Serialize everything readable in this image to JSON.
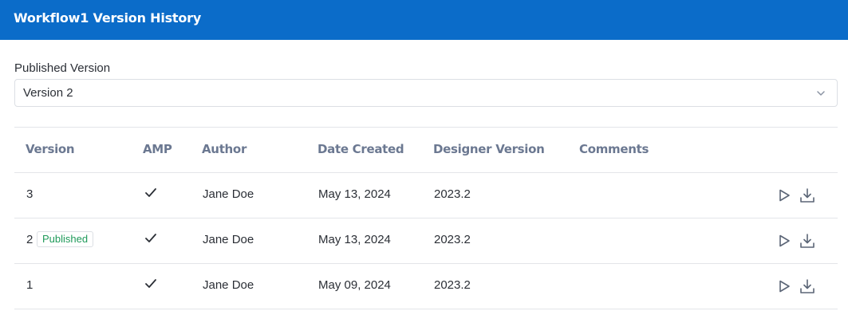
{
  "header": {
    "title": "Workflow1 Version History"
  },
  "published_select": {
    "label": "Published Version",
    "value": "Version 2",
    "icon": "chevron-down-icon"
  },
  "table": {
    "columns": [
      "Version",
      "AMP",
      "Author",
      "Date Created",
      "Designer Version",
      "Comments"
    ],
    "rows": [
      {
        "version": "3",
        "badge": "",
        "amp": true,
        "author": "Jane Doe",
        "date_created": "May 13, 2024",
        "designer_version": "2023.2",
        "comments": ""
      },
      {
        "version": "2",
        "badge": "Published",
        "amp": true,
        "author": "Jane Doe",
        "date_created": "May 13, 2024",
        "designer_version": "2023.2",
        "comments": ""
      },
      {
        "version": "1",
        "badge": "",
        "amp": true,
        "author": "Jane Doe",
        "date_created": "May 09, 2024",
        "designer_version": "2023.2",
        "comments": ""
      }
    ],
    "row_actions": [
      "play-icon",
      "download-icon"
    ]
  },
  "colors": {
    "header_bg": "#0b6cc9",
    "header_text": "#ffffff",
    "column_header_text": "#6b7891",
    "published_badge_text": "#1f9a5a",
    "divider": "#e3e5e9"
  }
}
